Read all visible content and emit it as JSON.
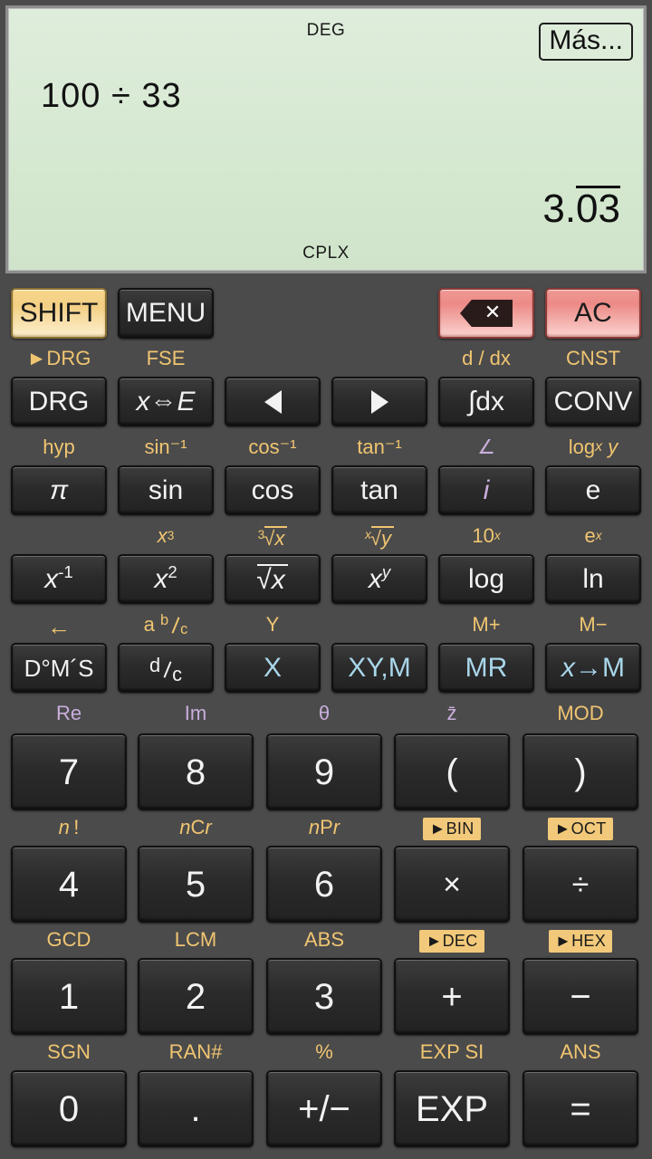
{
  "app": {
    "name": "scientific-calculator"
  },
  "display": {
    "angle_mode": "DEG",
    "complex_mode": "CPLX",
    "more_button": "Más...",
    "expression": "100 ÷ 33",
    "result_integer": "3.",
    "result_repeating": "03",
    "result_full": "3.03",
    "bg_color": "#d5e8d0",
    "border_color": "#8e8e8e"
  },
  "colors": {
    "background": "#4b4b4b",
    "key_face": "#2b2b2b",
    "shift_amber": "#f3cf84",
    "clear_red": "#ec8a86",
    "secondary_label": "#f0c571",
    "memory_blue": "#a9d6ea",
    "complex_violet": "#c9aedd",
    "chip_bg": "#f2c97a"
  },
  "toprow": {
    "keys": [
      {
        "label": "SHIFT",
        "style": "shift",
        "secondary": "►DRG"
      },
      {
        "label": "MENU",
        "style": "dark",
        "secondary": "FSE"
      },
      {
        "label": "",
        "style": "none",
        "secondary": ""
      },
      {
        "label": "",
        "style": "none",
        "secondary": ""
      },
      {
        "label": "backspace-icon",
        "style": "red",
        "secondary": "d / dx"
      },
      {
        "label": "AC",
        "style": "red",
        "secondary": "CNST"
      }
    ]
  },
  "rows": [
    {
      "name": "row-drg",
      "keys": [
        {
          "label": "DRG",
          "secondary": "hyp"
        },
        {
          "label": "x⇔E",
          "secondary": "sin⁻¹"
        },
        {
          "label": "◄",
          "secondary": "cos⁻¹"
        },
        {
          "label": "►",
          "secondary": "tan⁻¹"
        },
        {
          "label": "∫dx",
          "secondary": "∠"
        },
        {
          "label": "CONV",
          "secondary": "logx y"
        }
      ]
    },
    {
      "name": "row-trig",
      "keys": [
        {
          "label": "π",
          "secondary": "x³"
        },
        {
          "label": "sin",
          "secondary": "³√x"
        },
        {
          "label": "cos",
          "secondary": "x√y"
        },
        {
          "label": "tan",
          "secondary": "10ˣ"
        },
        {
          "label": "i",
          "secondary": "eˣ"
        },
        {
          "label": "e",
          "secondary": ""
        }
      ]
    },
    {
      "name": "row-power",
      "keys": [
        {
          "label": "x⁻¹",
          "secondary": "←"
        },
        {
          "label": "x²",
          "secondary": "a b/c"
        },
        {
          "label": "√x",
          "secondary": "Y"
        },
        {
          "label": "xʸ",
          "secondary": ""
        },
        {
          "label": "log",
          "secondary": "M+"
        },
        {
          "label": "ln",
          "secondary": "M−"
        }
      ]
    },
    {
      "name": "row-memory",
      "keys": [
        {
          "label": "D°M´S",
          "secondary": "Re"
        },
        {
          "label": "d/c",
          "secondary": "Im"
        },
        {
          "label": "X",
          "secondary": "θ"
        },
        {
          "label": "XY,M",
          "secondary": "z̄"
        },
        {
          "label": "MR",
          "secondary": "MOD"
        },
        {
          "label": "x→M",
          "secondary": ""
        }
      ]
    }
  ],
  "secondary_labels": {
    "row1": [
      "hyp",
      "sin⁻¹",
      "cos⁻¹",
      "tan⁻¹",
      "∠",
      "logx y"
    ],
    "row2": [
      "",
      "x³",
      "³√x",
      "x√y",
      "10ˣ",
      "eˣ"
    ],
    "row3": [
      "←",
      "a b/c",
      "Y",
      "",
      "M+",
      "M−"
    ],
    "row4": [
      "Re",
      "Im",
      "θ",
      "z̄",
      "MOD"
    ],
    "row5": [
      "n!",
      "nCr",
      "nPr",
      "►BIN",
      "►OCT"
    ],
    "row6": [
      "GCD",
      "LCM",
      "ABS",
      "►DEC",
      "►HEX"
    ],
    "row7": [
      "SGN",
      "RAN#",
      "%",
      "EXP SI",
      "ANS"
    ]
  },
  "numpad": [
    {
      "name": "row-789",
      "keys": [
        "7",
        "8",
        "9",
        "(",
        ")"
      ]
    },
    {
      "name": "row-456",
      "keys": [
        "4",
        "5",
        "6",
        "×",
        "÷"
      ]
    },
    {
      "name": "row-123",
      "keys": [
        "1",
        "2",
        "3",
        "+",
        "−"
      ]
    },
    {
      "name": "row-0",
      "keys": [
        "0",
        ".",
        "+/−",
        "EXP",
        "="
      ]
    }
  ]
}
